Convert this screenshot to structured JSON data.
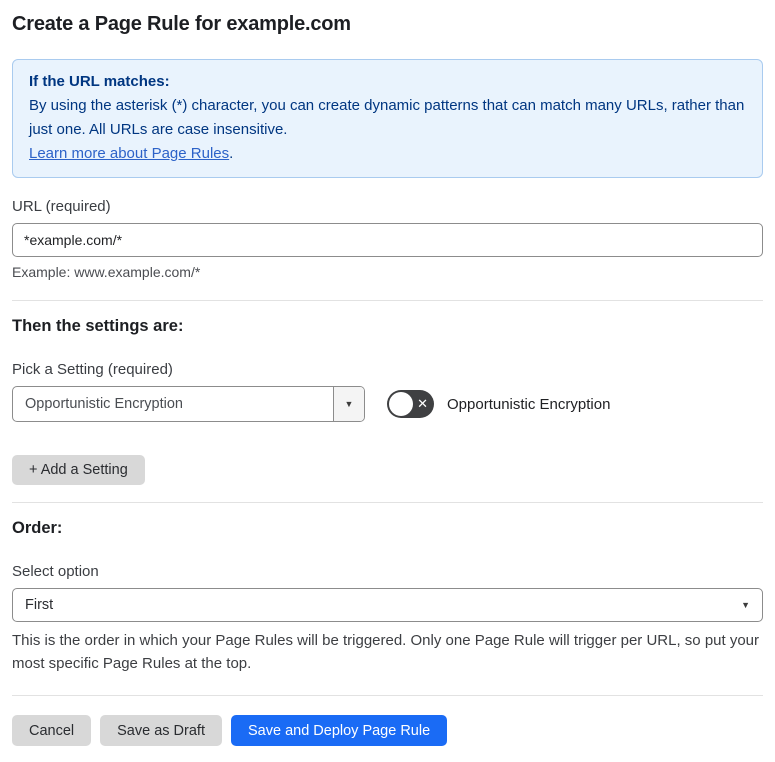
{
  "page": {
    "title": "Create a Page Rule for example.com"
  },
  "info_box": {
    "heading": "If the URL matches:",
    "body": "By using the asterisk (*) character, you can create dynamic patterns that can match many URLs, rather than just one. All URLs are case insensitive.",
    "link_label": "Learn more about Page Rules",
    "link_suffix": "."
  },
  "url_field": {
    "label": "URL (required)",
    "value": "*example.com/*",
    "helper": "Example: www.example.com/*"
  },
  "settings_section": {
    "heading": "Then the settings are:",
    "setting_label": "Pick a Setting (required)",
    "setting_value": "Opportunistic Encryption",
    "toggle_label": "Opportunistic Encryption",
    "toggle_state": "off",
    "toggle_icon": "✕",
    "dropdown_caret": "▼",
    "add_setting_label": "+ Add a Setting"
  },
  "order_section": {
    "heading": "Order:",
    "select_label": "Select option",
    "select_value": "First",
    "select_caret": "▼",
    "helper": "This is the order in which your Page Rules will be triggered. Only one Page Rule will trigger per URL, so put your most specific Page Rules at the top."
  },
  "footer": {
    "cancel_label": "Cancel",
    "save_draft_label": "Save as Draft",
    "save_deploy_label": "Save and Deploy Page Rule"
  },
  "colors": {
    "info_bg": "#e9f3fd",
    "info_border": "#a9cbef",
    "info_text": "#003681",
    "link_blue": "#2c62c8",
    "primary_button_bg": "#1a6bf5",
    "gray_button_bg": "#d8d8d8",
    "toggle_off_bg": "#3f4042",
    "input_border": "#8c8c8c",
    "divider": "#e2e2e2"
  }
}
